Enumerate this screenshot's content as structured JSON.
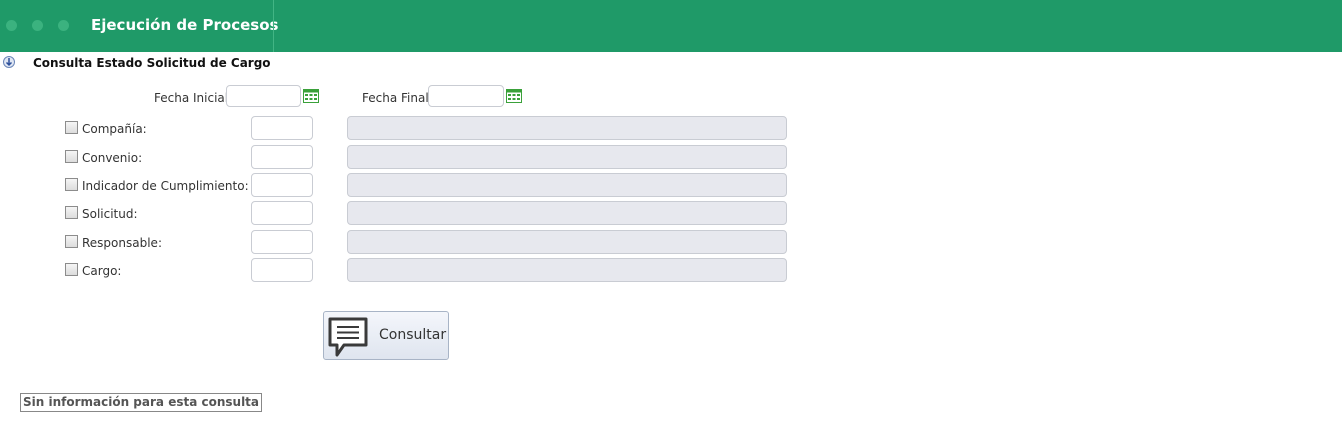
{
  "header": {
    "title": "Ejecución de Procesos"
  },
  "section": {
    "title": "Consulta Estado Solicitud de Cargo"
  },
  "dates": {
    "fecha_inicial_label": "Fecha Inicial:",
    "fecha_final_label": "Fecha Final:"
  },
  "filters": [
    {
      "label": "Compañía:"
    },
    {
      "label": "Convenio:"
    },
    {
      "label": "Indicador de Cumplimiento:"
    },
    {
      "label": "Solicitud:"
    },
    {
      "label": "Responsable:"
    },
    {
      "label": "Cargo:"
    }
  ],
  "actions": {
    "consultar_label": "Consultar"
  },
  "result": {
    "message": "Sin información para esta consulta"
  },
  "colors": {
    "header_bg": "#1f9a68",
    "disabled_field": "#e7e8ee",
    "calendar_icon": "#3aa13a"
  }
}
